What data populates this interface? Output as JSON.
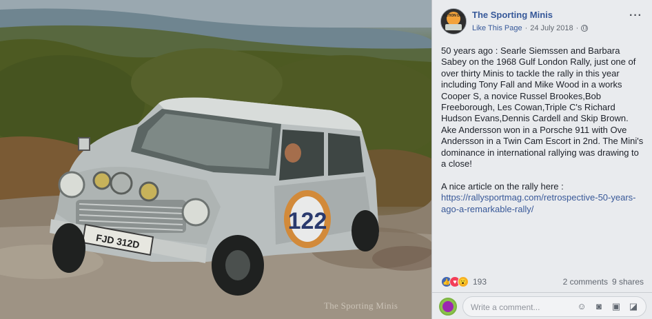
{
  "post": {
    "page_name": "The Sporting Minis",
    "like_label": "Like This Page",
    "separator": "·",
    "date": "24 July 2018",
    "more_label": "···",
    "body": "50 years ago : Searle Siemssen and Barbara Sabey on the 1968 Gulf London Rally, just one of over thirty Minis to tackle the rally in this year including Tony Fall and Mike Wood in a works Cooper S, a novice Russel Brookes,Bob Freeborough, Les Cowan,Triple C's Richard Hudson Evans,Dennis Cardell and Skip Brown. Ake Andersson won in a Porsche 911 with Ove Andersson in a Twin Cam Escort in 2nd. The Mini's dominance in international rallying was drawing to a close!\n\nA nice article on the rally here :\n",
    "link": "https://rallysportmag.com/retrospective-50-years-ago-a-remarkable-rally/",
    "privacy_icon": "globe-icon"
  },
  "photo": {
    "watermark": "The Sporting Minis",
    "plate": "FJD 312D",
    "race_number": "122"
  },
  "avatar_badge": "ACTION DAY",
  "stats": {
    "reactions": [
      "like",
      "love",
      "wow"
    ],
    "reaction_count": "193",
    "comments": "2 comments",
    "shares": "9 shares"
  },
  "composer": {
    "placeholder": "Write a comment...",
    "icons": [
      "emoji-icon",
      "camera-icon",
      "gif-icon",
      "sticker-icon"
    ]
  },
  "colors": {
    "link": "#385898",
    "page_name": "#365899",
    "panel_bg": "#e9ebee"
  }
}
